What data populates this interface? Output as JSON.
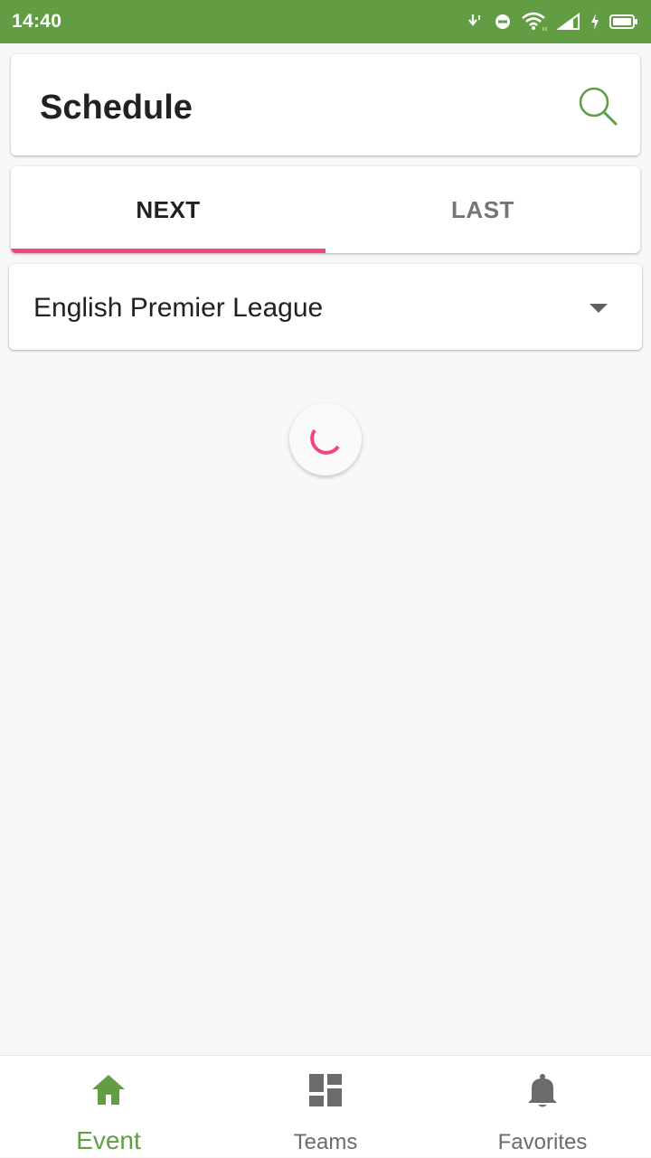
{
  "status_bar": {
    "time": "14:40",
    "icons": [
      "download-icon",
      "do-not-disturb-icon",
      "wifi-icon",
      "signal-icon",
      "charging-icon",
      "battery-icon"
    ]
  },
  "toolbar": {
    "title": "Schedule",
    "search_icon": "search-icon"
  },
  "tabs": [
    {
      "label": "NEXT",
      "active": true
    },
    {
      "label": "LAST",
      "active": false
    }
  ],
  "league_spinner": {
    "selected": "English Premier League"
  },
  "bottom_nav": {
    "items": [
      {
        "label": "Event",
        "icon": "home-icon",
        "active": true
      },
      {
        "label": "Teams",
        "icon": "dashboard-icon",
        "active": false
      },
      {
        "label": "Favorites",
        "icon": "bell-icon",
        "active": false
      }
    ]
  },
  "colors": {
    "primary": "#629d44",
    "accent": "#f1467b",
    "inactive": "#6b6b6b",
    "background": "#f8f8f8"
  }
}
